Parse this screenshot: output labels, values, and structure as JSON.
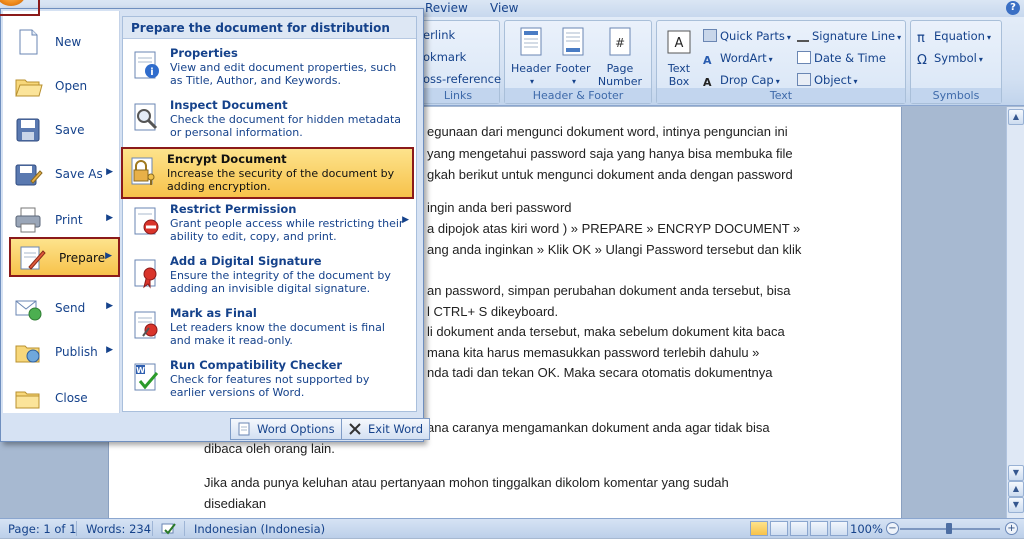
{
  "ribbon": {
    "tabs": [
      "Review",
      "View"
    ],
    "help_label": "?",
    "groups": {
      "links": {
        "label": "Links",
        "items": [
          "erlink",
          "okmark",
          "oss-reference"
        ]
      },
      "header_footer": {
        "label": "Header & Footer",
        "header": "Header",
        "footer": "Footer",
        "page_number_1": "Page",
        "page_number_2": "Number"
      },
      "text": {
        "label": "Text",
        "textbox_1": "Text",
        "textbox_2": "Box",
        "quick_parts": "Quick Parts",
        "wordart": "WordArt",
        "drop_cap": "Drop Cap",
        "signature_line": "Signature Line",
        "date_time": "Date & Time",
        "object": "Object"
      },
      "symbols": {
        "label": "Symbols",
        "equation": "Equation",
        "symbol": "Symbol"
      }
    }
  },
  "office_menu": {
    "left_items": [
      {
        "label": "New",
        "icon": "new-document-icon"
      },
      {
        "label": "Open",
        "icon": "open-folder-icon"
      },
      {
        "label": "Save",
        "icon": "save-disk-icon"
      },
      {
        "label": "Save As",
        "icon": "save-as-icon"
      },
      {
        "label": "Print",
        "icon": "printer-icon"
      },
      {
        "label": "Prepare",
        "icon": "prepare-icon"
      },
      {
        "label": "Send",
        "icon": "send-icon"
      },
      {
        "label": "Publish",
        "icon": "publish-icon"
      },
      {
        "label": "Close",
        "icon": "close-folder-icon"
      }
    ],
    "submenu_title": "Prepare the document for distribution",
    "submenu_items": [
      {
        "title": "Properties",
        "desc": "View and edit document properties, such as Title, Author, and Keywords.",
        "icon": "properties-icon"
      },
      {
        "title": "Inspect Document",
        "desc": "Check the document for hidden metadata or personal information.",
        "icon": "inspect-icon"
      },
      {
        "title": "Encrypt Document",
        "desc": "Increase the security of the document by adding encryption.",
        "icon": "lock-key-icon"
      },
      {
        "title": "Restrict Permission",
        "desc": "Grant people access while restricting their ability to edit, copy, and print.",
        "icon": "restrict-icon"
      },
      {
        "title": "Add a Digital Signature",
        "desc": "Ensure the integrity of the document by adding an invisible digital signature.",
        "icon": "signature-ribbon-icon"
      },
      {
        "title": "Mark as Final",
        "desc": "Let readers know the document is final and make it read-only.",
        "icon": "mark-final-icon"
      },
      {
        "title": "Run Compatibility Checker",
        "desc": "Check for features not supported by earlier versions of Word.",
        "icon": "compatibility-icon"
      }
    ],
    "word_options": "Word Options",
    "exit_word": "Exit Word"
  },
  "document": {
    "lines": [
      "egunaan dari mengunci dokument word, intinya penguncian ini",
      "yang mengetahui password saja yang hanya bisa membuka file",
      "gkah berikut untuk mengunci dokument anda dengan password",
      "ingin anda beri password",
      "a dipojok atas kiri word ) » PREPARE » ENCRYP DOCUMENT »",
      "ang anda inginkan » Klik OK » Ulangi Password tersebut dan klik",
      "an password, simpan perubahan dokument anda tersebut, bisa",
      "l CTRL+ S dikeyboard.",
      "li dokument anda tersebut, maka sebelum dokument kita baca",
      "mana kita harus memasukkan password terlebih dahulu »",
      "nda tadi dan tekan OK. Maka secara otomatis dokumentnya",
      "ana caranya mengamankan dokument anda agar tidak bisa",
      "dibaca oleh orang lain.",
      "Jika anda punya keluhan atau pertanyaan mohon tinggalkan dikolom komentar yang sudah",
      "disediakan"
    ]
  },
  "status_bar": {
    "page": "Page: 1 of 1",
    "words": "Words: 234",
    "language": "Indonesian (Indonesia)",
    "zoom": "100%",
    "zoom_minus": "−",
    "zoom_plus": "+"
  },
  "colors": {
    "selection_border": "#8b1a1a",
    "highlight": "#f7c24b",
    "ribbon_text": "#15428b"
  }
}
